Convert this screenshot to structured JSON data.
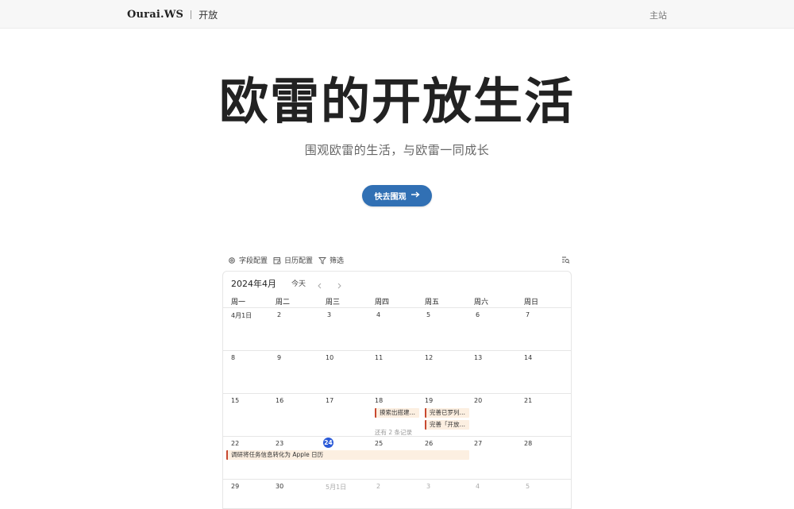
{
  "header": {
    "brand": "Ourai.WS",
    "section": "开放",
    "home_link": "主站"
  },
  "hero": {
    "title": "欧雷的开放生活",
    "subtitle": "围观欧雷的生活，与欧雷一同成长",
    "cta_label": "快去围观",
    "cta_icon": "arrow-right-icon"
  },
  "toolbar": {
    "fields": "字段配置",
    "calendar_config": "日历配置",
    "filter": "筛选"
  },
  "calendar": {
    "month": "2024年4月",
    "today_label": "今天",
    "weekdays": [
      "周一",
      "周二",
      "周三",
      "周四",
      "周五",
      "周六",
      "周日"
    ],
    "weeks": [
      [
        "4月1日",
        "2",
        "3",
        "4",
        "5",
        "6",
        "7"
      ],
      [
        "8",
        "9",
        "10",
        "11",
        "12",
        "13",
        "14"
      ],
      [
        "15",
        "16",
        "17",
        "18",
        "19",
        "20",
        "21"
      ],
      [
        "22",
        "23",
        "24",
        "25",
        "26",
        "27",
        "28"
      ],
      [
        "29",
        "30",
        "5月1日",
        "2",
        "3",
        "4",
        "5"
      ]
    ],
    "today": "24",
    "events": [
      {
        "title": "摸索出搭建…"
      },
      {
        "title": "完善已罗列…"
      },
      {
        "title": "完善「开放…"
      },
      {
        "title": "调研将任务信息转化为 Apple 日历"
      }
    ],
    "more_label": "还有 2 条记录"
  },
  "colors": {
    "accent": "#3170b4",
    "today": "#2a5ad8",
    "event_bg": "#fcefe1",
    "event_bar": "#c8482f"
  }
}
